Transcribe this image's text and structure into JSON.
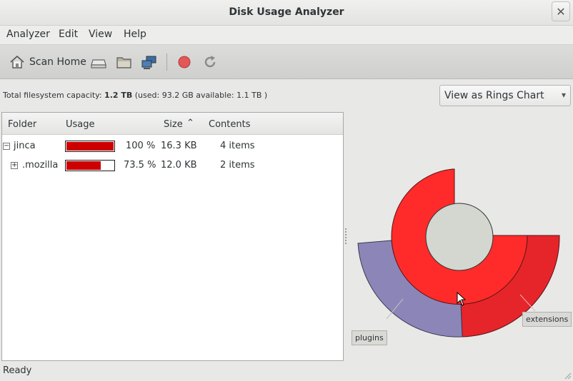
{
  "window": {
    "title": "Disk Usage Analyzer"
  },
  "menu": {
    "items": [
      "Analyzer",
      "Edit",
      "View",
      "Help"
    ]
  },
  "toolbar": {
    "scan_home_label": "Scan Home"
  },
  "info": {
    "capacity_prefix": "Total filesystem capacity: ",
    "capacity_total": "1.2 TB",
    "capacity_suffix": " (used: 93.2 GB available: 1.1 TB )"
  },
  "view_select": {
    "selected": "View as Rings Chart"
  },
  "tree": {
    "columns": {
      "folder": "Folder",
      "usage": "Usage",
      "size": "Size",
      "contents": "Contents"
    },
    "rows": [
      {
        "name": "jinca",
        "expander": "−",
        "percent": "100 %",
        "fraction": 1.0,
        "size": "16.3 KB",
        "contents": "4 items"
      },
      {
        "name": ".mozilla",
        "expander": "+",
        "percent": "73.5 %",
        "fraction": 0.735,
        "size": "12.0 KB",
        "contents": "2 items"
      }
    ]
  },
  "chart": {
    "labels": {
      "plugins": "plugins",
      "extensions": "extensions"
    },
    "colors": {
      "center": "#d3d7cf",
      "ring1": "#ff2b2b",
      "plugins": "#8c86b8",
      "extensions": "#e5252a"
    }
  },
  "status": {
    "text": "Ready"
  }
}
